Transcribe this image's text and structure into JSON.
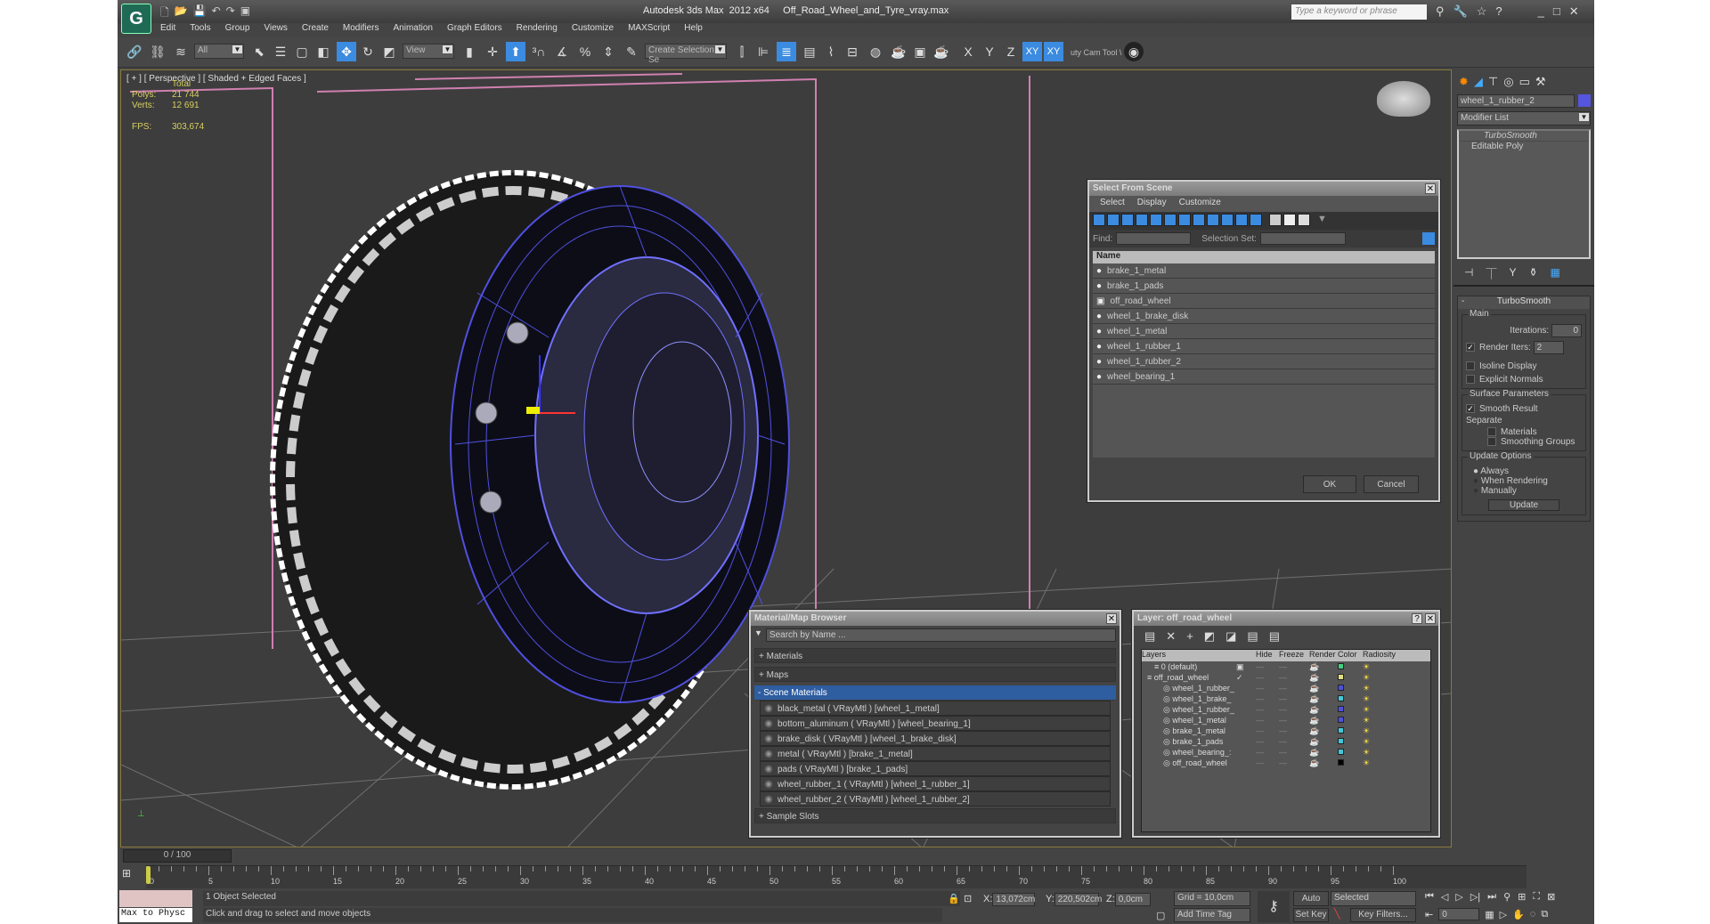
{
  "app": {
    "title": "Autodesk 3ds Max  2012 x64     Off_Road_Wheel_and_Tyre_vray.max",
    "search_placeholder": "Type a keyword or phrase"
  },
  "menu": [
    "Edit",
    "Tools",
    "Group",
    "Views",
    "Create",
    "Modifiers",
    "Animation",
    "Graph Editors",
    "Rendering",
    "Customize",
    "MAXScript",
    "Help"
  ],
  "toolbar": {
    "filter": "All",
    "ref_coord": "View",
    "selection_set": "Create Selection Se",
    "axis": [
      "X",
      "Y",
      "Z",
      "XY",
      "XY"
    ],
    "cam_tool": "uty Cam Tool \\"
  },
  "viewport": {
    "label": "[ + ] [ Perspective ] [ Shaded + Edged Faces ]",
    "stats": {
      "header": "Total",
      "polys_label": "Polys:",
      "polys": "21 744",
      "verts_label": "Verts:",
      "verts": "12 691",
      "fps_label": "FPS:",
      "fps": "303,674"
    }
  },
  "command_panel": {
    "object_name": "wheel_1_rubber_2",
    "object_color": "#5555dd",
    "modifier_list": "Modifier List",
    "stack": [
      "TurboSmooth",
      "Editable Poly"
    ],
    "rollout": "TurboSmooth",
    "main": "Main",
    "iterations_label": "Iterations:",
    "iterations": "0",
    "render_iters_label": "Render Iters:",
    "render_iters": "2",
    "isoline": "Isoline Display",
    "explicit": "Explicit Normals",
    "surface": "Surface Parameters",
    "smooth_result": "Smooth Result",
    "separate": "Separate",
    "materials": "Materials",
    "smoothing_groups": "Smoothing Groups",
    "update_options": "Update Options",
    "always": "Always",
    "when_rendering": "When Rendering",
    "manually": "Manually",
    "update": "Update"
  },
  "select_scene": {
    "title": "Select From Scene",
    "menu": [
      "Select",
      "Display",
      "Customize"
    ],
    "find_label": "Find:",
    "selset_label": "Selection Set:",
    "column": "Name",
    "items": [
      "brake_1_metal",
      "brake_1_pads",
      "off_road_wheel",
      "wheel_1_brake_disk",
      "wheel_1_metal",
      "wheel_1_rubber_1",
      "wheel_1_rubber_2",
      "wheel_bearing_1"
    ],
    "ok": "OK",
    "cancel": "Cancel"
  },
  "material_browser": {
    "title": "Material/Map Browser",
    "search_placeholder": "Search by Name ...",
    "sections": [
      "+ Materials",
      "+ Maps",
      "- Scene Materials",
      "+ Sample Slots"
    ],
    "materials": [
      "black_metal  ( VRayMtl )  [wheel_1_metal]",
      "bottom_aluminum  ( VRayMtl )  [wheel_bearing_1]",
      "brake_disk  ( VRayMtl )  [wheel_1_brake_disk]",
      "metal  ( VRayMtl )  [brake_1_metal]",
      "pads  ( VRayMtl )  [brake_1_pads]",
      "wheel_rubber_1  ( VRayMtl )  [wheel_1_rubber_1]",
      "wheel_rubber_2  ( VRayMtl )  [wheel_1_rubber_2]"
    ]
  },
  "layer_dialog": {
    "title": "Layer: off_road_wheel",
    "columns": [
      "Layers",
      "",
      "Hide",
      "Freeze",
      "Render",
      "Color",
      "Radiosity"
    ],
    "rows": [
      {
        "name": "0 (default)",
        "color": "#40d080"
      },
      {
        "name": "off_road_wheel",
        "color": "#e0e080"
      },
      {
        "name": "wheel_1_rubber_",
        "color": "#5050e0"
      },
      {
        "name": "wheel_1_brake_",
        "color": "#40c8d8"
      },
      {
        "name": "wheel_1_rubber_",
        "color": "#5050e0"
      },
      {
        "name": "wheel_1_metal",
        "color": "#5050e0"
      },
      {
        "name": "brake_1_metal",
        "color": "#40c8d8"
      },
      {
        "name": "brake_1_pads",
        "color": "#40c8d8"
      },
      {
        "name": "wheel_bearing_:",
        "color": "#40c8d8"
      },
      {
        "name": "off_road_wheel",
        "color": "#000000"
      }
    ]
  },
  "timeline": {
    "frame": "0 / 100",
    "ticks": [
      "0",
      "5",
      "10",
      "15",
      "20",
      "25",
      "30",
      "35",
      "40",
      "45",
      "50",
      "55",
      "60",
      "65",
      "70",
      "75",
      "80",
      "85",
      "90",
      "95",
      "100"
    ]
  },
  "status": {
    "script": "Max to Physc",
    "selected": "1 Object Selected",
    "prompt": "Click and drag to select and move objects",
    "x_label": "X:",
    "x": "13,072cm",
    "y_label": "Y:",
    "y": "220,502cm",
    "z_label": "Z:",
    "z": "0,0cm",
    "grid": "Grid = 10,0cm",
    "add_time_tag": "Add Time Tag",
    "auto_key": "Auto Key",
    "set_key": "Set Key",
    "key_mode": "Selected",
    "key_filters": "Key Filters...",
    "current_frame": "0"
  }
}
